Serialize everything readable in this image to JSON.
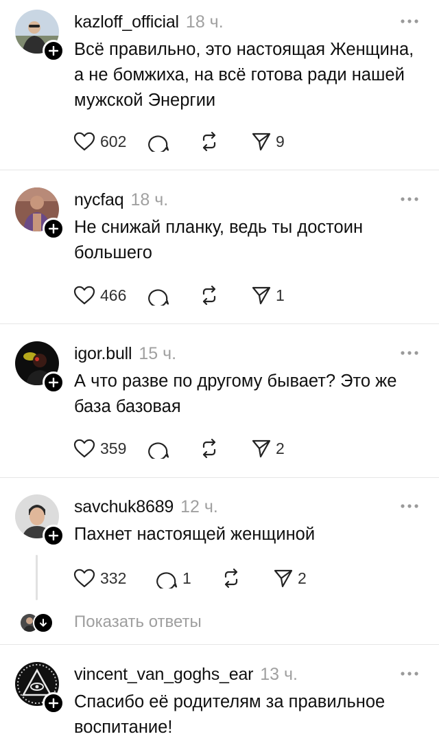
{
  "comments": [
    {
      "username": "kazloff_official",
      "time": "18 ч.",
      "text": "Всё правильно, это настоящая Женщина, а не бомжиха, на всё готова ради нашей мужской Энергии",
      "likes": "602",
      "replies": "",
      "shares": "9"
    },
    {
      "username": "nycfaq",
      "time": "18 ч.",
      "text": "Не снижай планку, ведь ты достоин большего",
      "likes": "466",
      "replies": "",
      "shares": "1"
    },
    {
      "username": "igor.bull",
      "time": "15 ч.",
      "text": "А что разве по другому бывает? Это же база базовая",
      "likes": "359",
      "replies": "",
      "shares": "2"
    },
    {
      "username": "savchuk8689",
      "time": "12 ч.",
      "text": "Пахнет настоящей женщиной",
      "likes": "332",
      "replies": "1",
      "shares": "2"
    },
    {
      "username": "vincent_van_goghs_ear",
      "time": "13 ч.",
      "text": "Спасибо её родителям за правильное воспитание!",
      "likes": "",
      "replies": "",
      "shares": ""
    }
  ],
  "show_replies_label": "Показать ответы",
  "icons": {
    "like": "heart-icon",
    "reply": "speech-bubble-icon",
    "repost": "repost-icon",
    "share": "send-icon",
    "more": "more-dots-icon",
    "follow": "plus-icon",
    "expand": "arrow-down-icon"
  },
  "colors": {
    "text": "#101010",
    "muted": "#a0a0a0",
    "divider": "#e6e6e6"
  }
}
